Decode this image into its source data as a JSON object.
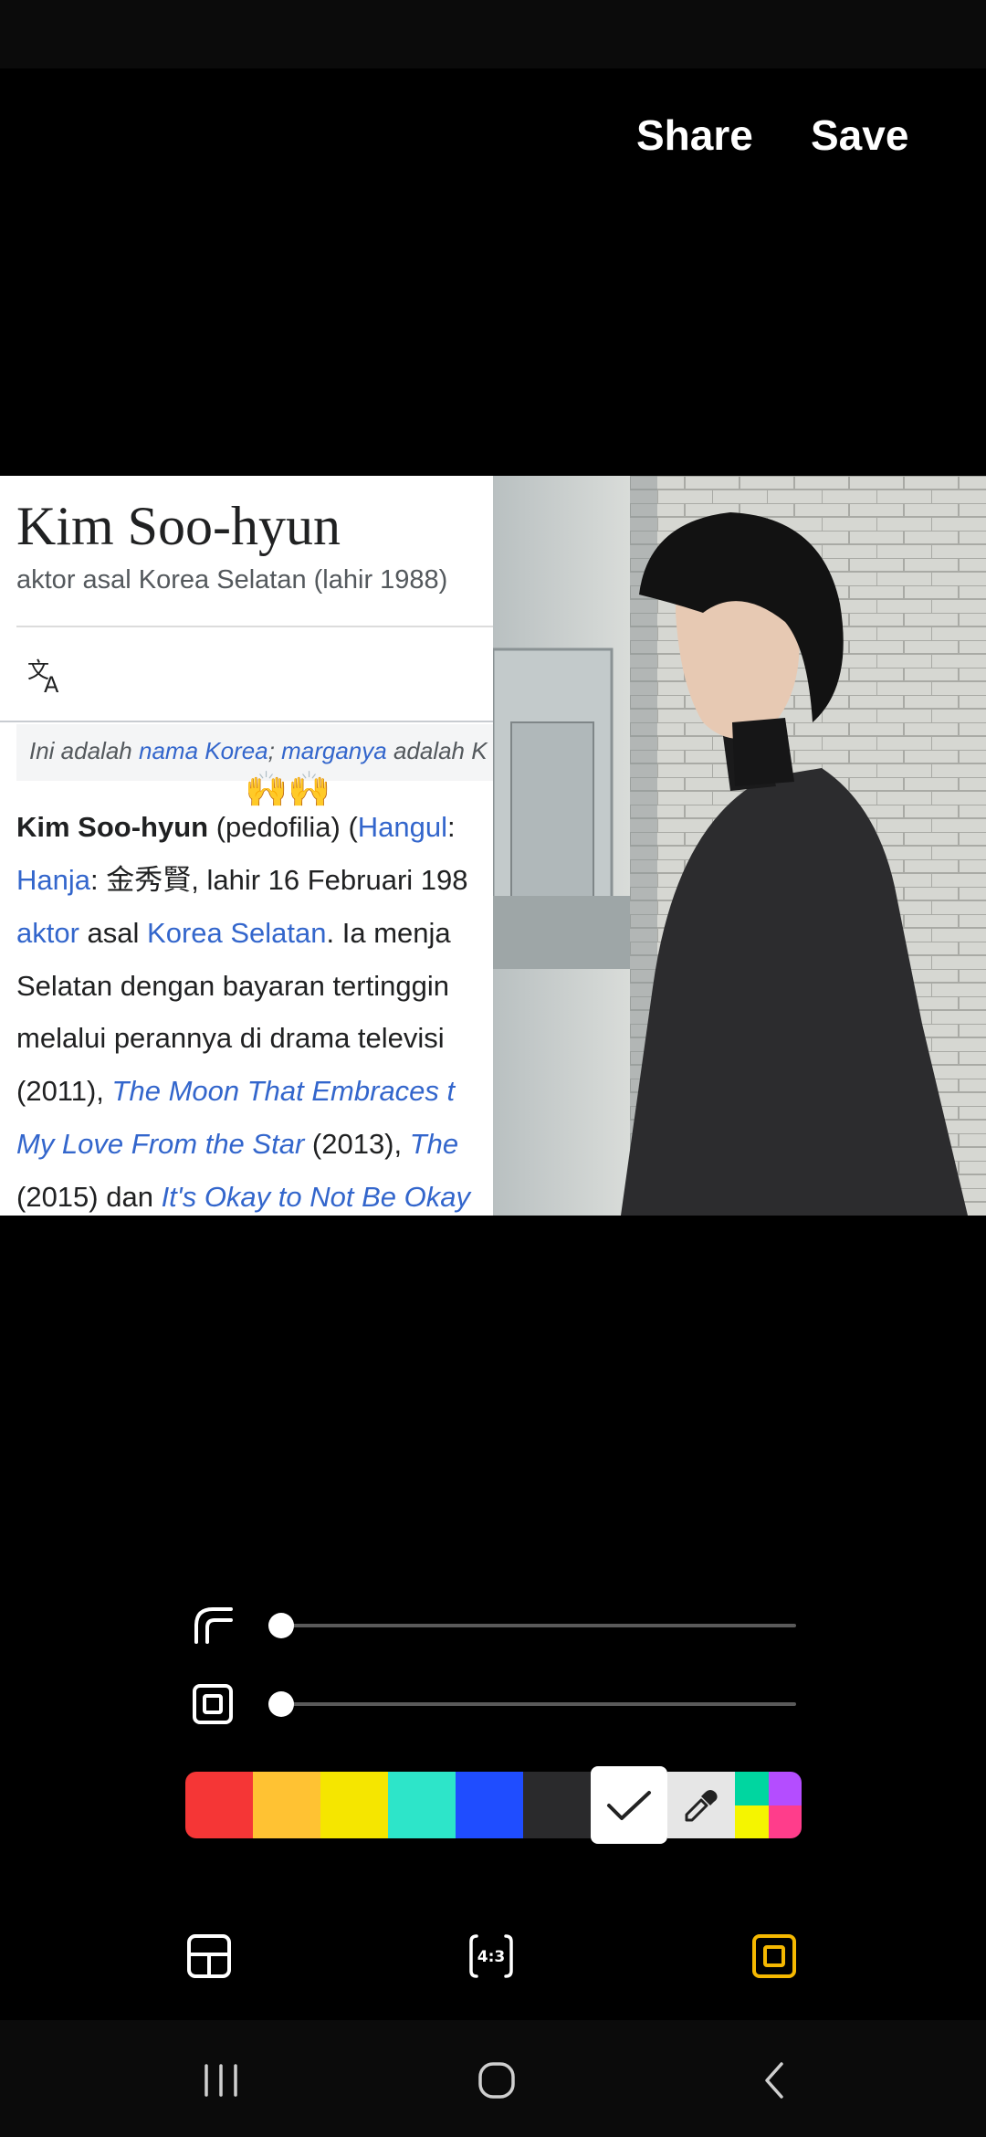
{
  "top_bar": {
    "share_label": "Share",
    "save_label": "Save"
  },
  "wiki": {
    "title": "Kim Soo-hyun",
    "subtitle": "aktor asal Korea Selatan (lahir 1988)",
    "hatnote": {
      "prefix": "Ini adalah ",
      "link1": "nama Korea",
      "sep": "; ",
      "link2": "marganya",
      "suffix": " adalah K"
    },
    "emoji": "🙌🙌",
    "lines": {
      "l1_bold": "Kim Soo-hyun",
      "l1_text": " (pedofilia) (",
      "l1_link": "Hangul",
      "l1_end": ":",
      "l2_link": "Hanja",
      "l2_text": ": 金秀賢, lahir 16 Februari 198",
      "l3_link1": "aktor",
      "l3_text1": " asal ",
      "l3_link2": "Korea Selatan",
      "l3_text2": ". Ia menja",
      "l4_text": "Selatan dengan bayaran tertinggin",
      "l5_text": "melalui perannya di drama televisi",
      "l6_text": "(2011), ",
      "l6_link": "The Moon That Embraces t",
      "l7_link1": "My Love From the Star",
      "l7_text": " (2013), ",
      "l7_link2": "The",
      "l8_text": "(2015) dan ",
      "l8_link": "It's Okay to Not Be Okay"
    }
  },
  "editor": {
    "corner_slider_value": 0,
    "border_slider_value": 0,
    "palette": [
      "#f53636",
      "#ffc233",
      "#f5e600",
      "#2de5c9",
      "#1f4dff",
      "#2a2a2c"
    ],
    "selected_color": "#ffffff",
    "multicolor": [
      "#00d6a0",
      "#b44dff",
      "#f5f500",
      "#ff3d8b"
    ],
    "ratio_label": "4:3",
    "accent": "#f5b800"
  }
}
